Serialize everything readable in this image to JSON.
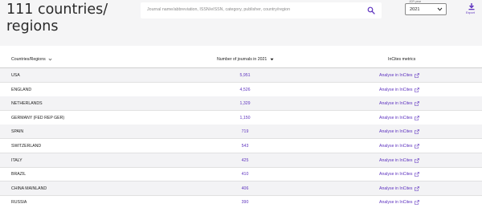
{
  "header": {
    "title": "111 countries/ regions",
    "search_placeholder": "Journal name/abbreviation, ISSN/eISSN, category, publisher, country/region",
    "jcr_year_label": "JCR year",
    "jcr_year_value": "2021",
    "export_label": "Export"
  },
  "table": {
    "columns": {
      "country": "Countries/Regions",
      "num_journals": "Number of journals in 2021",
      "metrics": "InCites metrics"
    },
    "rows": [
      {
        "country": "USA",
        "count": "5,951",
        "link": "Analyse in InCites"
      },
      {
        "country": "ENGLAND",
        "count": "4,526",
        "link": "Analyse in InCites"
      },
      {
        "country": "NETHERLANDS",
        "count": "1,329",
        "link": "Analyse in InCites"
      },
      {
        "country": "GERMANY (FED REP GER)",
        "count": "1,150",
        "link": "Analyse in InCites"
      },
      {
        "country": "SPAIN",
        "count": "719",
        "link": "Analyse in InCites"
      },
      {
        "country": "SWITZERLAND",
        "count": "543",
        "link": "Analyse in InCites"
      },
      {
        "country": "ITALY",
        "count": "425",
        "link": "Analyse in InCites"
      },
      {
        "country": "BRAZIL",
        "count": "410",
        "link": "Analyse in InCites"
      },
      {
        "country": "CHINA MAINLAND",
        "count": "406",
        "link": "Analyse in InCites"
      },
      {
        "country": "RUSSIA",
        "count": "390",
        "link": "Analyse in InCites"
      }
    ]
  },
  "colors": {
    "accent": "#5e33bf",
    "header_bg": "#f5f5f6",
    "row_alt_bg": "#f3f3f5"
  },
  "icons": {
    "search": "search-icon",
    "export": "download-icon",
    "external": "external-link-icon",
    "caret": "chevron-down-icon"
  }
}
